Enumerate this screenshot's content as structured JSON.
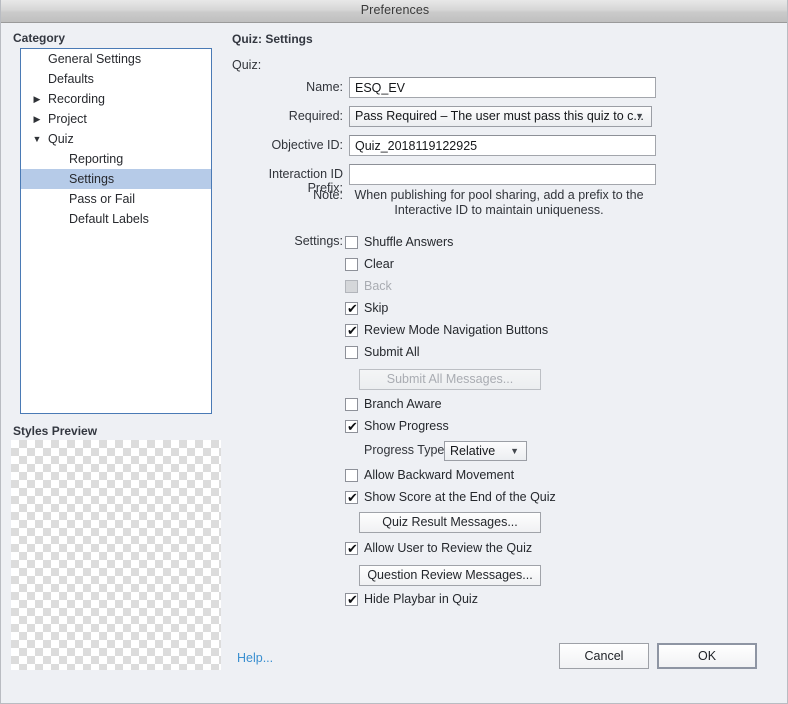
{
  "window": {
    "title": "Preferences"
  },
  "sidebar": {
    "heading": "Category",
    "items": [
      {
        "label": "General Settings",
        "level": 1,
        "twisty": "",
        "selected": false
      },
      {
        "label": "Defaults",
        "level": 1,
        "twisty": "",
        "selected": false
      },
      {
        "label": "Recording",
        "level": 1,
        "twisty": "collapsed",
        "selected": false
      },
      {
        "label": "Project",
        "level": 1,
        "twisty": "collapsed",
        "selected": false
      },
      {
        "label": "Quiz",
        "level": 1,
        "twisty": "expanded",
        "selected": false
      },
      {
        "label": "Reporting",
        "level": 2,
        "twisty": "",
        "selected": false
      },
      {
        "label": "Settings",
        "level": 2,
        "twisty": "",
        "selected": true
      },
      {
        "label": "Pass or Fail",
        "level": 2,
        "twisty": "",
        "selected": false
      },
      {
        "label": "Default Labels",
        "level": 2,
        "twisty": "",
        "selected": false
      }
    ],
    "styles_preview_heading": "Styles Preview"
  },
  "panel": {
    "title": "Quiz: Settings",
    "group_label": "Quiz:",
    "fields": {
      "name_label": "Name:",
      "name_value": "ESQ_EV",
      "required_label": "Required:",
      "required_value": "Pass Required – The user must pass this quiz to c...",
      "objective_label": "Objective ID:",
      "objective_value": "Quiz_2018119122925",
      "interaction_label": "Interaction ID Prefix:",
      "interaction_value": "",
      "interaction_placeholder": ""
    },
    "note": {
      "lead": "Note:",
      "body": "When publishing for pool sharing, add a prefix to the Interactive ID to maintain uniqueness."
    },
    "settings_label": "Settings:",
    "checkboxes": [
      {
        "label": "Shuffle Answers",
        "checked": false,
        "enabled": true
      },
      {
        "label": "Clear",
        "checked": false,
        "enabled": true
      },
      {
        "label": "Back",
        "checked": false,
        "enabled": false
      },
      {
        "label": "Skip",
        "checked": true,
        "enabled": true
      },
      {
        "label": "Review Mode Navigation Buttons",
        "checked": true,
        "enabled": true
      },
      {
        "label": "Submit All",
        "checked": false,
        "enabled": true
      },
      {
        "label": "Branch Aware",
        "checked": false,
        "enabled": true
      },
      {
        "label": "Show Progress",
        "checked": true,
        "enabled": true
      },
      {
        "label": "Allow Backward Movement",
        "checked": false,
        "enabled": true
      },
      {
        "label": "Show Score at the End of the Quiz",
        "checked": true,
        "enabled": true
      },
      {
        "label": "Allow User to Review the Quiz",
        "checked": true,
        "enabled": true
      },
      {
        "label": "Hide Playbar in Quiz",
        "checked": true,
        "enabled": true
      }
    ],
    "buttons": {
      "submit_all_messages": "Submit All Messages...",
      "quiz_result_messages": "Quiz Result Messages...",
      "question_review_messages": "Question Review Messages..."
    },
    "progress_type": {
      "label": "Progress Type:",
      "value": "Relative"
    }
  },
  "footer": {
    "help": "Help...",
    "cancel": "Cancel",
    "ok": "OK"
  },
  "glyphs": {
    "check": "✔",
    "arrow_down": "▼",
    "arrow_right": "▶"
  }
}
